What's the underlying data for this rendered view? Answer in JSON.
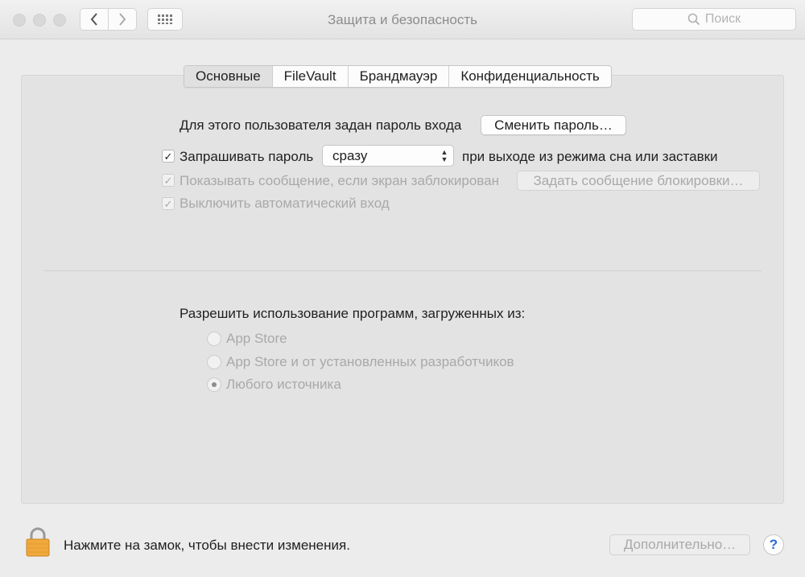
{
  "window": {
    "title": "Защита и безопасность"
  },
  "toolbar": {
    "back_icon": "chevron-left-icon",
    "forward_icon": "chevron-right-icon",
    "grid_icon": "grid-icon",
    "search_placeholder": "Поиск"
  },
  "tabs": [
    {
      "label": "Основные",
      "active": true
    },
    {
      "label": "FileVault",
      "active": false
    },
    {
      "label": "Брандмауэр",
      "active": false
    },
    {
      "label": "Конфиденциальность",
      "active": false
    }
  ],
  "general": {
    "password_set_text": "Для этого пользователя задан пароль входа",
    "change_password_button": "Сменить пароль…",
    "require_password": {
      "label": "Запрашивать пароль",
      "checked": true,
      "select_value": "сразу",
      "suffix": "при выходе из режима сна или заставки"
    },
    "show_message": {
      "label": "Показывать сообщение, если экран заблокирован",
      "checked": true,
      "disabled": true,
      "button": "Задать сообщение блокировки…"
    },
    "disable_auto_login": {
      "label": "Выключить автоматический вход",
      "checked": true,
      "disabled": true
    }
  },
  "apps": {
    "heading": "Разрешить использование программ, загруженных из:",
    "options": [
      {
        "label": "App Store",
        "selected": false
      },
      {
        "label": "App Store и от установленных разработчиков",
        "selected": false
      },
      {
        "label": "Любого источника",
        "selected": true
      }
    ]
  },
  "footer": {
    "lock_icon": "lock-icon",
    "lock_text": "Нажмите на замок, чтобы внести изменения.",
    "advanced_button": "Дополнительно…",
    "help_label": "?"
  },
  "colors": {
    "lock": "#f0a93a",
    "help": "#2a6bd8",
    "background": "#ececec"
  }
}
